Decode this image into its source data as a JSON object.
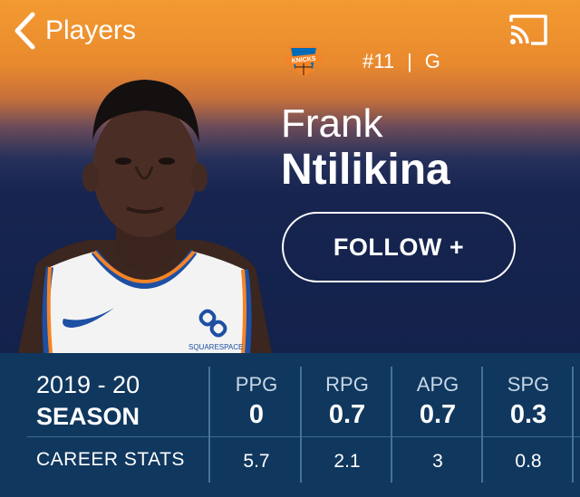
{
  "nav": {
    "back_label": "Players"
  },
  "player": {
    "number": "#11",
    "separator": "|",
    "position": "G",
    "first_name": "Frank",
    "last_name": "Ntilikina",
    "jersey_sponsor": "SQUARESPACE"
  },
  "actions": {
    "follow_label": "FOLLOW +"
  },
  "stats": {
    "season_year": "2019 - 20",
    "season_label": "SEASON",
    "career_label": "CAREER STATS",
    "columns": [
      {
        "head": "PPG",
        "season": "0",
        "career": "5.7"
      },
      {
        "head": "RPG",
        "season": "0.7",
        "career": "2.1"
      },
      {
        "head": "APG",
        "season": "0.7",
        "career": "3"
      },
      {
        "head": "SPG",
        "season": "0.3",
        "career": "0.8"
      }
    ]
  },
  "colors": {
    "header_top": "#f39a30",
    "header_bottom": "#13224b",
    "stats_bg": "#10375e",
    "knicks_orange": "#f58426",
    "knicks_blue": "#006bb6"
  },
  "icons": [
    "chevron-left-icon",
    "cast-icon",
    "knicks-logo"
  ]
}
